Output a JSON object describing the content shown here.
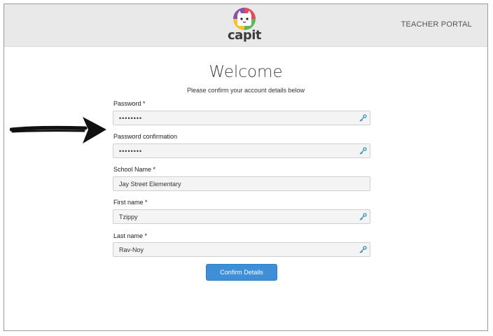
{
  "header": {
    "logo_text": "capit",
    "portal_link": "TEACHER PORTAL"
  },
  "main": {
    "title": "Welcome",
    "subtitle": "Please confirm your account details below",
    "fields": [
      {
        "label": "Password *",
        "value": "••••••••",
        "type": "password"
      },
      {
        "label": "Password confirmation",
        "value": "••••••••",
        "type": "password"
      },
      {
        "label": "School Name *",
        "value": "Jay Street Elementary",
        "type": "text"
      },
      {
        "label": "First name *",
        "value": "Tzippy",
        "type": "text"
      },
      {
        "label": "Last name *",
        "value": "Rav-Noy",
        "type": "text"
      }
    ],
    "confirm_label": "Confirm Details"
  },
  "colors": {
    "accent": "#3f8fd6",
    "key_icon": "#3a8fb8",
    "header_bg": "#e9e9e9"
  },
  "icons": {
    "field_icon": "key-icon",
    "annotation": "arrow-icon"
  }
}
